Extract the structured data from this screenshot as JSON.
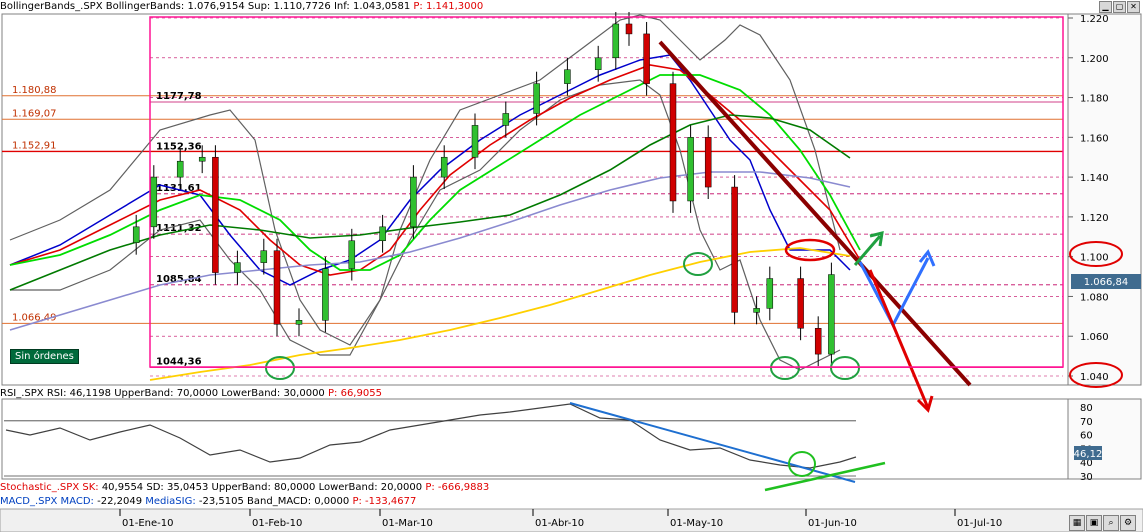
{
  "main_header": {
    "name": "BollingerBands_.SPX BollingerBands:",
    "value": "1.076,9154",
    "sup_label": "Sup:",
    "sup_value": "1.110,7726",
    "inf_label": "Inf:",
    "inf_value": "1.043,0581",
    "p_label": "P:",
    "p_value": "1.141,3000"
  },
  "rsi_header": {
    "name": "RSI_.SPX RSI:",
    "value": "46,1198",
    "upper_label": "UpperBand:",
    "upper_value": "70,0000",
    "lower_label": "LowerBand:",
    "lower_value": "30,0000",
    "p_label": "P:",
    "p_value": "66,9055"
  },
  "stoch_header": {
    "name": "Stochastic_.SPX SK:",
    "sk": "40,9554",
    "sd_label": "SD:",
    "sd": "35,0453",
    "upper_label": "UpperBand:",
    "upper_value": "80,0000",
    "lower_label": "LowerBand:",
    "lower_value": "20,0000",
    "p_label": "P:",
    "p_value": "-666,9883"
  },
  "macd_header": {
    "name": "MACD_.SPX MACD:",
    "macd": "-22,2049",
    "signal_label": "MediaSIG:",
    "signal": "-23,5105",
    "band_label": "Band_MACD:",
    "band": "0,0000",
    "p_label": "P:",
    "p_value": "-133,4677"
  },
  "price_axis": {
    "ticks": [
      "1.220",
      "1.200",
      "1.180",
      "1.160",
      "1.140",
      "1.120",
      "1.100",
      "1.080",
      "1.060",
      "1.040"
    ],
    "current_price": "1.066,84"
  },
  "rsi_axis": {
    "ticks": [
      "80",
      "70",
      "60",
      "50",
      "40",
      "30"
    ],
    "current": "46,12"
  },
  "levels_left": [
    "1.180,88",
    "1.169,07",
    "1.152,91",
    "1.066,49"
  ],
  "levels_inner": [
    "1177,78",
    "1152,36",
    "1131,61",
    "1111,32",
    "1085,84",
    "1044,36"
  ],
  "dates": [
    "01-Ene-10",
    "01-Feb-10",
    "01-Mar-10",
    "01-Abr-10",
    "01-May-10",
    "01-Jun-10",
    "01-Jul-10"
  ],
  "orders_button": "Sin órdenes",
  "chart_data": {
    "type": "candlestick",
    "series": [
      {
        "name": "SPX",
        "x": [
          "2010-01-04",
          "2010-01-08",
          "2010-01-14",
          "2010-01-19",
          "2010-01-22",
          "2010-01-27",
          "2010-02-02",
          "2010-02-05",
          "2010-02-10",
          "2010-02-16",
          "2010-02-22",
          "2010-03-01",
          "2010-03-08",
          "2010-03-15",
          "2010-03-22",
          "2010-03-29",
          "2010-04-05",
          "2010-04-12",
          "2010-04-19",
          "2010-04-23",
          "2010-04-26",
          "2010-04-30",
          "2010-05-06",
          "2010-05-10",
          "2010-05-14",
          "2010-05-20",
          "2010-05-25",
          "2010-05-28",
          "2010-06-04",
          "2010-06-08",
          "2010-06-11"
        ],
        "close": [
          1115,
          1140,
          1148,
          1150,
          1092,
          1097,
          1103,
          1066,
          1068,
          1094,
          1108,
          1115,
          1140,
          1150,
          1166,
          1172,
          1187,
          1194,
          1200,
          1217,
          1212,
          1187,
          1128,
          1160,
          1135,
          1072,
          1074,
          1089,
          1064,
          1051,
          1091
        ]
      }
    ],
    "ylim": [
      1035,
      1225
    ],
    "reference_levels": [
      1180.88,
      1169.07,
      1152.91,
      1066.49,
      1177.78,
      1152.36,
      1131.61,
      1111.32,
      1085.84,
      1044.36
    ],
    "rsi": {
      "ylim": [
        30,
        80
      ],
      "current": 46.12
    }
  },
  "colors": {
    "frame": "#ff1493",
    "red": "#e00000",
    "blue_band": "#0000cc",
    "green_ma": "#00dd00",
    "dark_green_ma": "#007a00",
    "yellow_ma": "#ffd000",
    "purple_ma": "#8a8ad0",
    "bb_gray": "#606060",
    "trend_dark": "#8b0000",
    "up_arrow_green": "#20a040",
    "up_arrow_blue": "#3070ff"
  }
}
